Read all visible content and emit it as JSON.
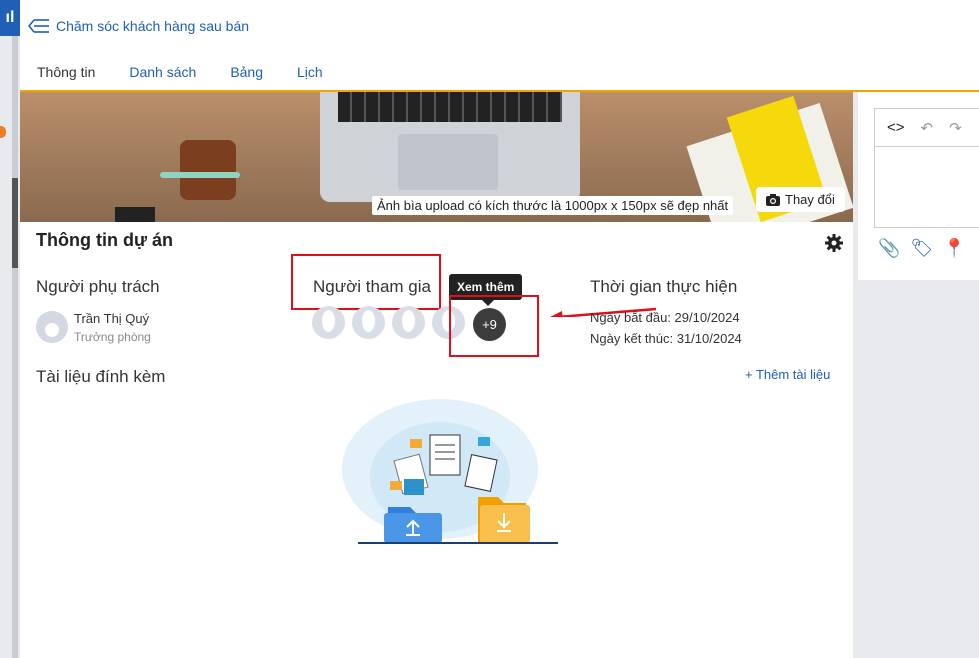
{
  "header": {
    "back_label": "Chăm sóc khách hàng sau bán",
    "tabs": [
      "Thông tin",
      "Danh sách",
      "Bảng",
      "Lịch"
    ]
  },
  "cover": {
    "note": "Ảnh bìa upload có kích thước là 1000px x 150px sẽ đẹp nhất",
    "change_label": "Thay đổi"
  },
  "project": {
    "title": "Thông tin dự án",
    "owner_heading": "Người phụ trách",
    "owner_name": "Trần Thị Quý",
    "owner_role": "Trưởng phòng",
    "participants_heading": "Người tham gia",
    "participants_more": "+9",
    "tooltip": "Xem thêm",
    "time_heading": "Thời gian thực hiện",
    "start": "Ngày bắt đầu: 29/10/2024",
    "end": "Ngày kết thúc: 31/10/2024"
  },
  "attachments": {
    "heading": "Tài liệu đính kèm",
    "add_label": "+ Thêm tài liệu"
  },
  "editor": {
    "code_icon": "<>",
    "undo_icon": "undo-icon",
    "redo_icon": "redo-icon"
  },
  "colors": {
    "accent_blue": "#1f5fb5",
    "tab_underline": "#f0a500",
    "highlight_red": "#e0101a"
  }
}
